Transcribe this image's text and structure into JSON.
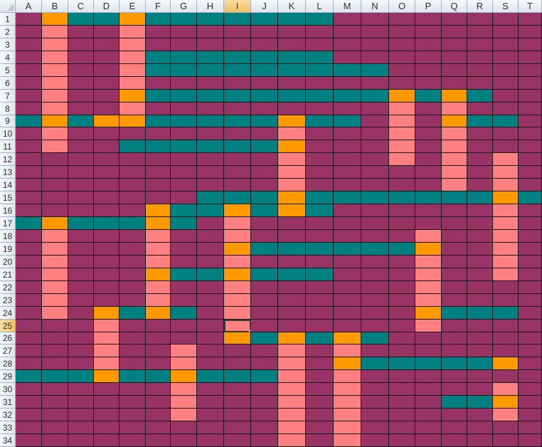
{
  "spreadsheet": {
    "columns": [
      "A",
      "B",
      "C",
      "D",
      "E",
      "F",
      "G",
      "H",
      "I",
      "J",
      "K",
      "L",
      "M",
      "N",
      "O",
      "P",
      "Q",
      "R",
      "S",
      "T"
    ],
    "rows": [
      "1",
      "2",
      "3",
      "4",
      "5",
      "6",
      "7",
      "8",
      "9",
      "10",
      "11",
      "12",
      "13",
      "14",
      "15",
      "16",
      "17",
      "18",
      "19",
      "20",
      "21",
      "22",
      "23",
      "24",
      "25",
      "26",
      "27",
      "28",
      "29",
      "30",
      "31",
      "32",
      "33",
      "34"
    ],
    "active_cell": "I25",
    "colors": {
      "P": "#993366",
      "T": "#008080",
      "S": "#ff8080",
      "O": "#ff9900"
    },
    "grid": [
      "POTTOTTTTTTTPPPPPPPP",
      "PSPPSPPPPPPPPPPPPPPP",
      "PSPPSPPPPPPPPPPPPPPP",
      "PSPPSTTTTTTTPPPPPPPP",
      "PSPPSTTTTTTTTTPPPPPP",
      "PSPPSPPPPPPPPPPPPPPP",
      "PSPPOTTTTTTTTTOTOTPP",
      "PSPPSPPPPPPPPPSPSPPP",
      "TOTOOTTTTTOTTPSPOTTP",
      "PSPPPPPPPPSPPPSPSPPP",
      "PSPPTTTTTTOPPPSPSPPP",
      "PPPPPPPPPPSPPPSPSPSP",
      "PPPPPPPPPPSPPPPPSPSP",
      "PPPPPPPPPPSPPPPPSPSP",
      "PPPPPPPTTTOTTTTTTTOT",
      "PPPPPOTTOTOTPPPPPPSP",
      "TOTTTOTPSPPPPPPPPPSP",
      "PSPPPSPPSPPPPPPSPPSP",
      "PSPPPSPPOTTTTTTOPPSP",
      "PSPPPSPPSPPPPPPSPPSP",
      "PSPPPOTTOTTTPPPSPPSP",
      "PSPPPSPPSPPPPPPSPPPP",
      "PSPPPSPPSPPPPPPSPPPP",
      "PSPOTOTPSPPPPPPOTTTP",
      "PPPSPPPPSPPPPPPSPPPP",
      "PPPSPPPPOTOTOTPPPPPP",
      "PPPSPPSPPPSPSPPPPPPP",
      "PPPSPPSPPPSPOTTTTTOP",
      "TTTOTTOTTTSPSPPPPPPP",
      "PPPPPPSPPPSPSPPPPPSP",
      "PPPPPPSPPPSPSPPPTTOP",
      "PPPPPPSPPPSPSPPPPPSP",
      "PPPPPPPPPPSPSPPPPPPP",
      "PPPPPPPPPPSPSPPPPPPP"
    ]
  }
}
